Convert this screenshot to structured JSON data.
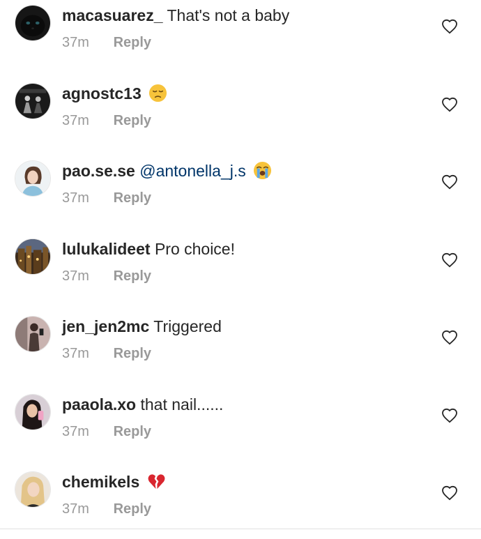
{
  "comments": [
    {
      "username": "macasuarez_",
      "text": "That's not a baby",
      "mention": "",
      "emoji": "",
      "time": "37m",
      "reply": "Reply",
      "avatar_icon": "black-cat-avatar",
      "like_icon": "heart-outline-icon"
    },
    {
      "username": "agnostc13",
      "text": "",
      "mention": "",
      "emoji": "pensive-face-emoji",
      "time": "37m",
      "reply": "Reply",
      "avatar_icon": "dark-figures-avatar",
      "like_icon": "heart-outline-icon"
    },
    {
      "username": "pao.se.se",
      "text": "",
      "mention": "@antonella_j.s",
      "emoji": "loudly-crying-face-emoji",
      "time": "37m",
      "reply": "Reply",
      "avatar_icon": "girl-portrait-avatar",
      "like_icon": "heart-outline-icon"
    },
    {
      "username": "lulukalideet",
      "text": "Pro choice!",
      "mention": "",
      "emoji": "",
      "time": "37m",
      "reply": "Reply",
      "avatar_icon": "city-night-avatar",
      "like_icon": "heart-outline-icon"
    },
    {
      "username": "jen_jen2mc",
      "text": "Triggered",
      "mention": "",
      "emoji": "",
      "time": "37m",
      "reply": "Reply",
      "avatar_icon": "mirror-selfie-avatar",
      "like_icon": "heart-outline-icon"
    },
    {
      "username": "paaola.xo",
      "text": "that nail......",
      "mention": "",
      "emoji": "",
      "time": "37m",
      "reply": "Reply",
      "avatar_icon": "dark-hair-selfie-avatar",
      "like_icon": "heart-outline-icon"
    },
    {
      "username": "chemikels",
      "text": "",
      "mention": "",
      "emoji": "broken-heart-emoji",
      "time": "37m",
      "reply": "Reply",
      "avatar_icon": "blonde-selfie-avatar",
      "like_icon": "heart-outline-icon"
    }
  ],
  "colors": {
    "username": "#262626",
    "meta": "#999999",
    "mention": "#003569",
    "heart_stroke": "#262626",
    "divider": "#e0e0e0"
  }
}
